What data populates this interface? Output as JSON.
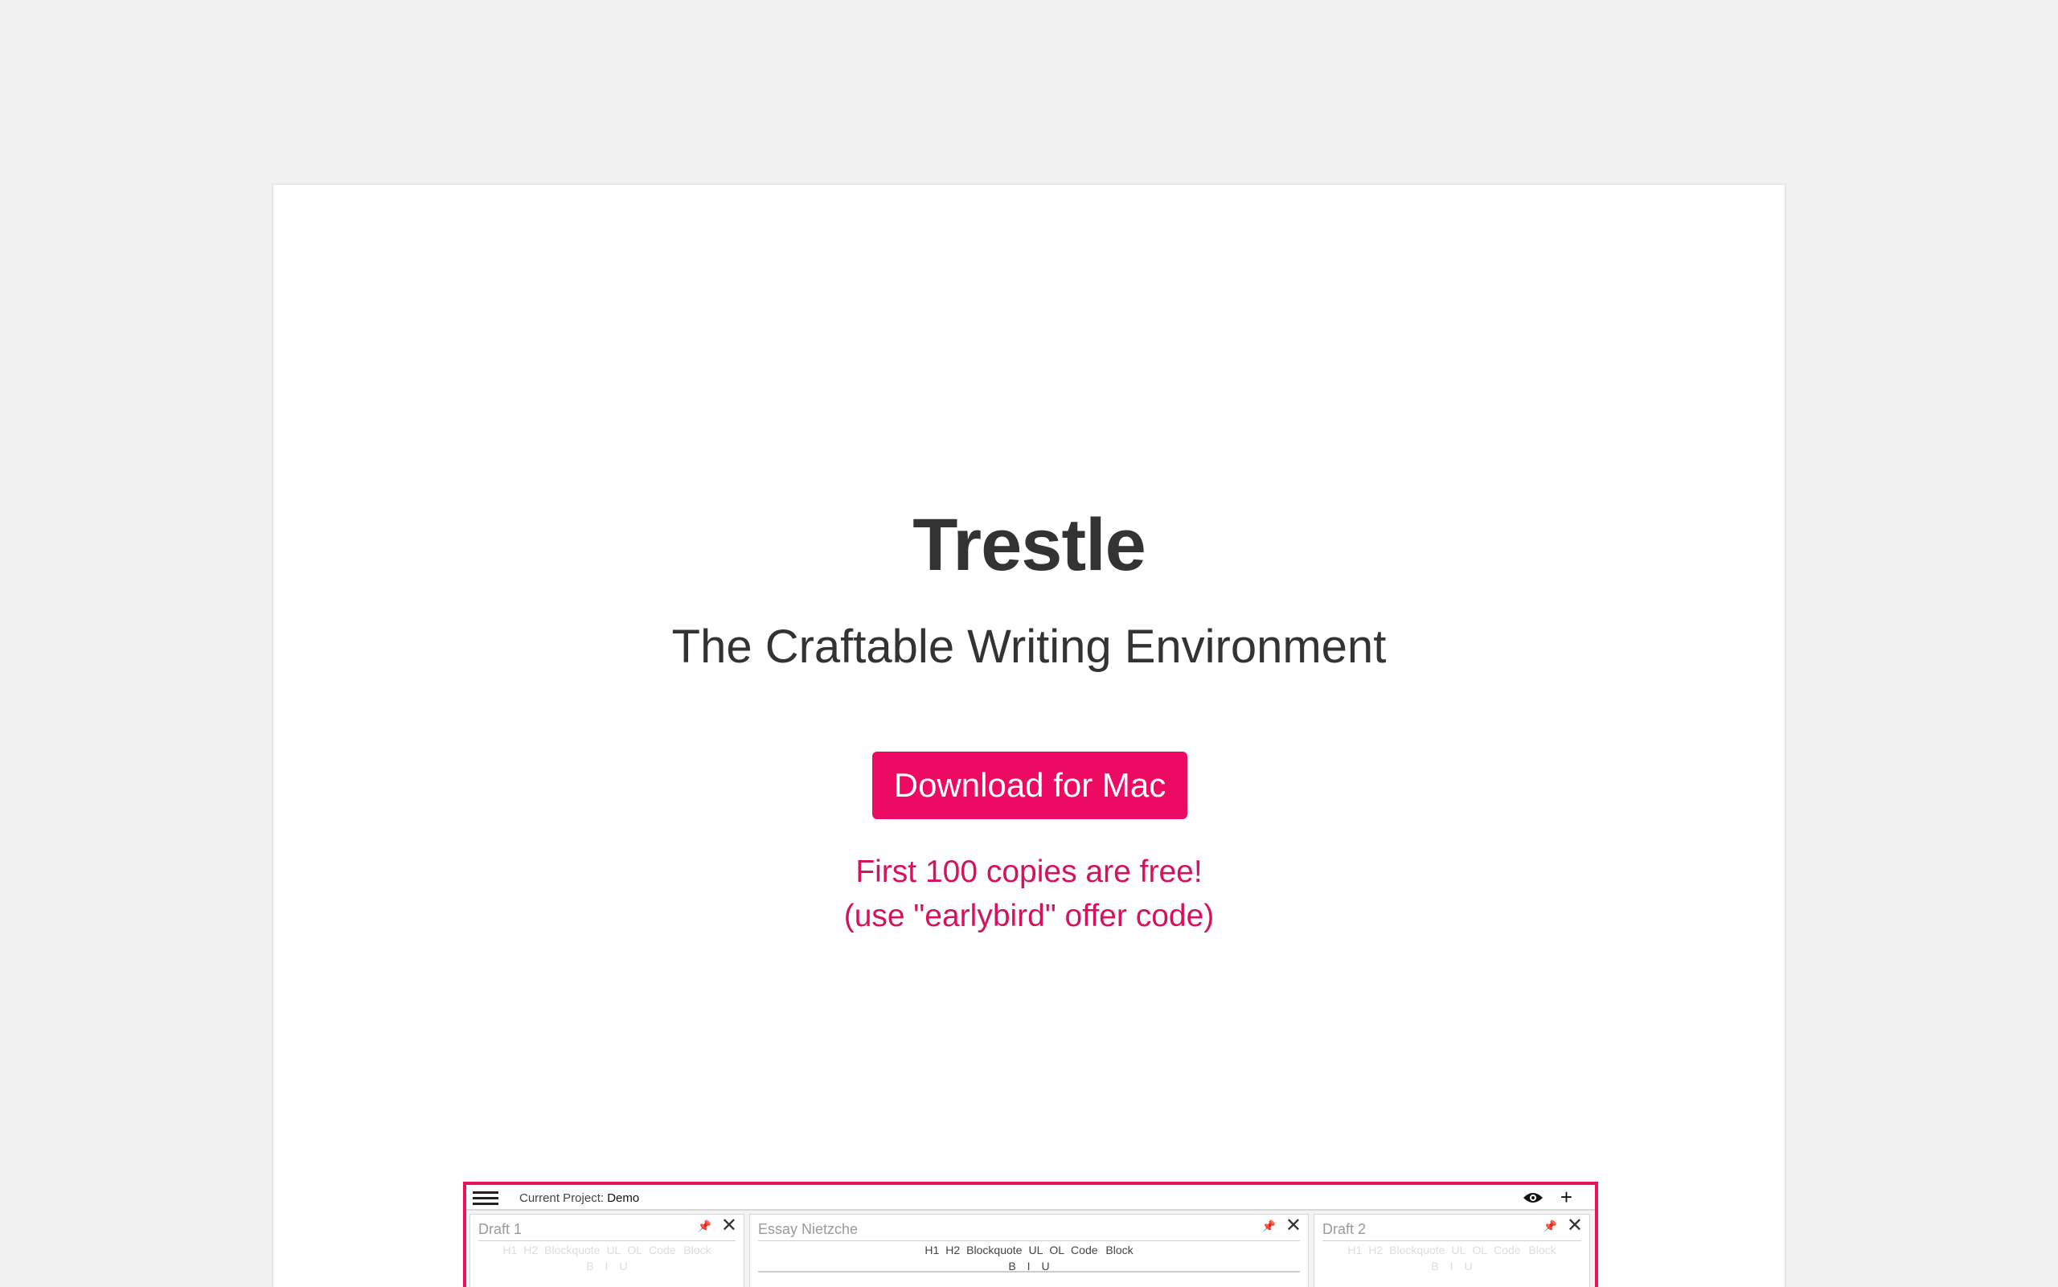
{
  "hero": {
    "title": "Trestle",
    "subtitle": "The Craftable Writing Environment",
    "download_label": "Download for Mac",
    "offer_line1": "First 100 copies are free!",
    "offer_line2": "(use \"earlybird\" offer code)"
  },
  "colors": {
    "accent": "#ec0a62",
    "offer_text": "#d4125e",
    "page_bg": "#f1f0f1",
    "card_bg": "#ffffff"
  },
  "preview": {
    "project_label": "Current Project:",
    "project_name": "Demo",
    "icons": [
      "menu-icon",
      "eye-icon",
      "plus-icon",
      "pin-icon",
      "close-icon"
    ],
    "panes": [
      {
        "title": "Draft 1",
        "toolbar": [
          "H1",
          "H2",
          "Blockquote",
          "UL",
          "OL",
          "Code Block"
        ],
        "format": [
          "B",
          "I",
          "U"
        ]
      },
      {
        "title": "Essay Nietzche",
        "toolbar": [
          "H1",
          "H2",
          "Blockquote",
          "UL",
          "OL",
          "Code Block"
        ],
        "format": [
          "B",
          "I",
          "U"
        ]
      },
      {
        "title": "Draft 2",
        "toolbar": [
          "H1",
          "H2",
          "Blockquote",
          "UL",
          "OL",
          "Code Block"
        ],
        "format": [
          "B",
          "I",
          "U"
        ]
      }
    ],
    "pin_glyph": "📌",
    "close_glyph": "✕",
    "plus_glyph": "+"
  }
}
